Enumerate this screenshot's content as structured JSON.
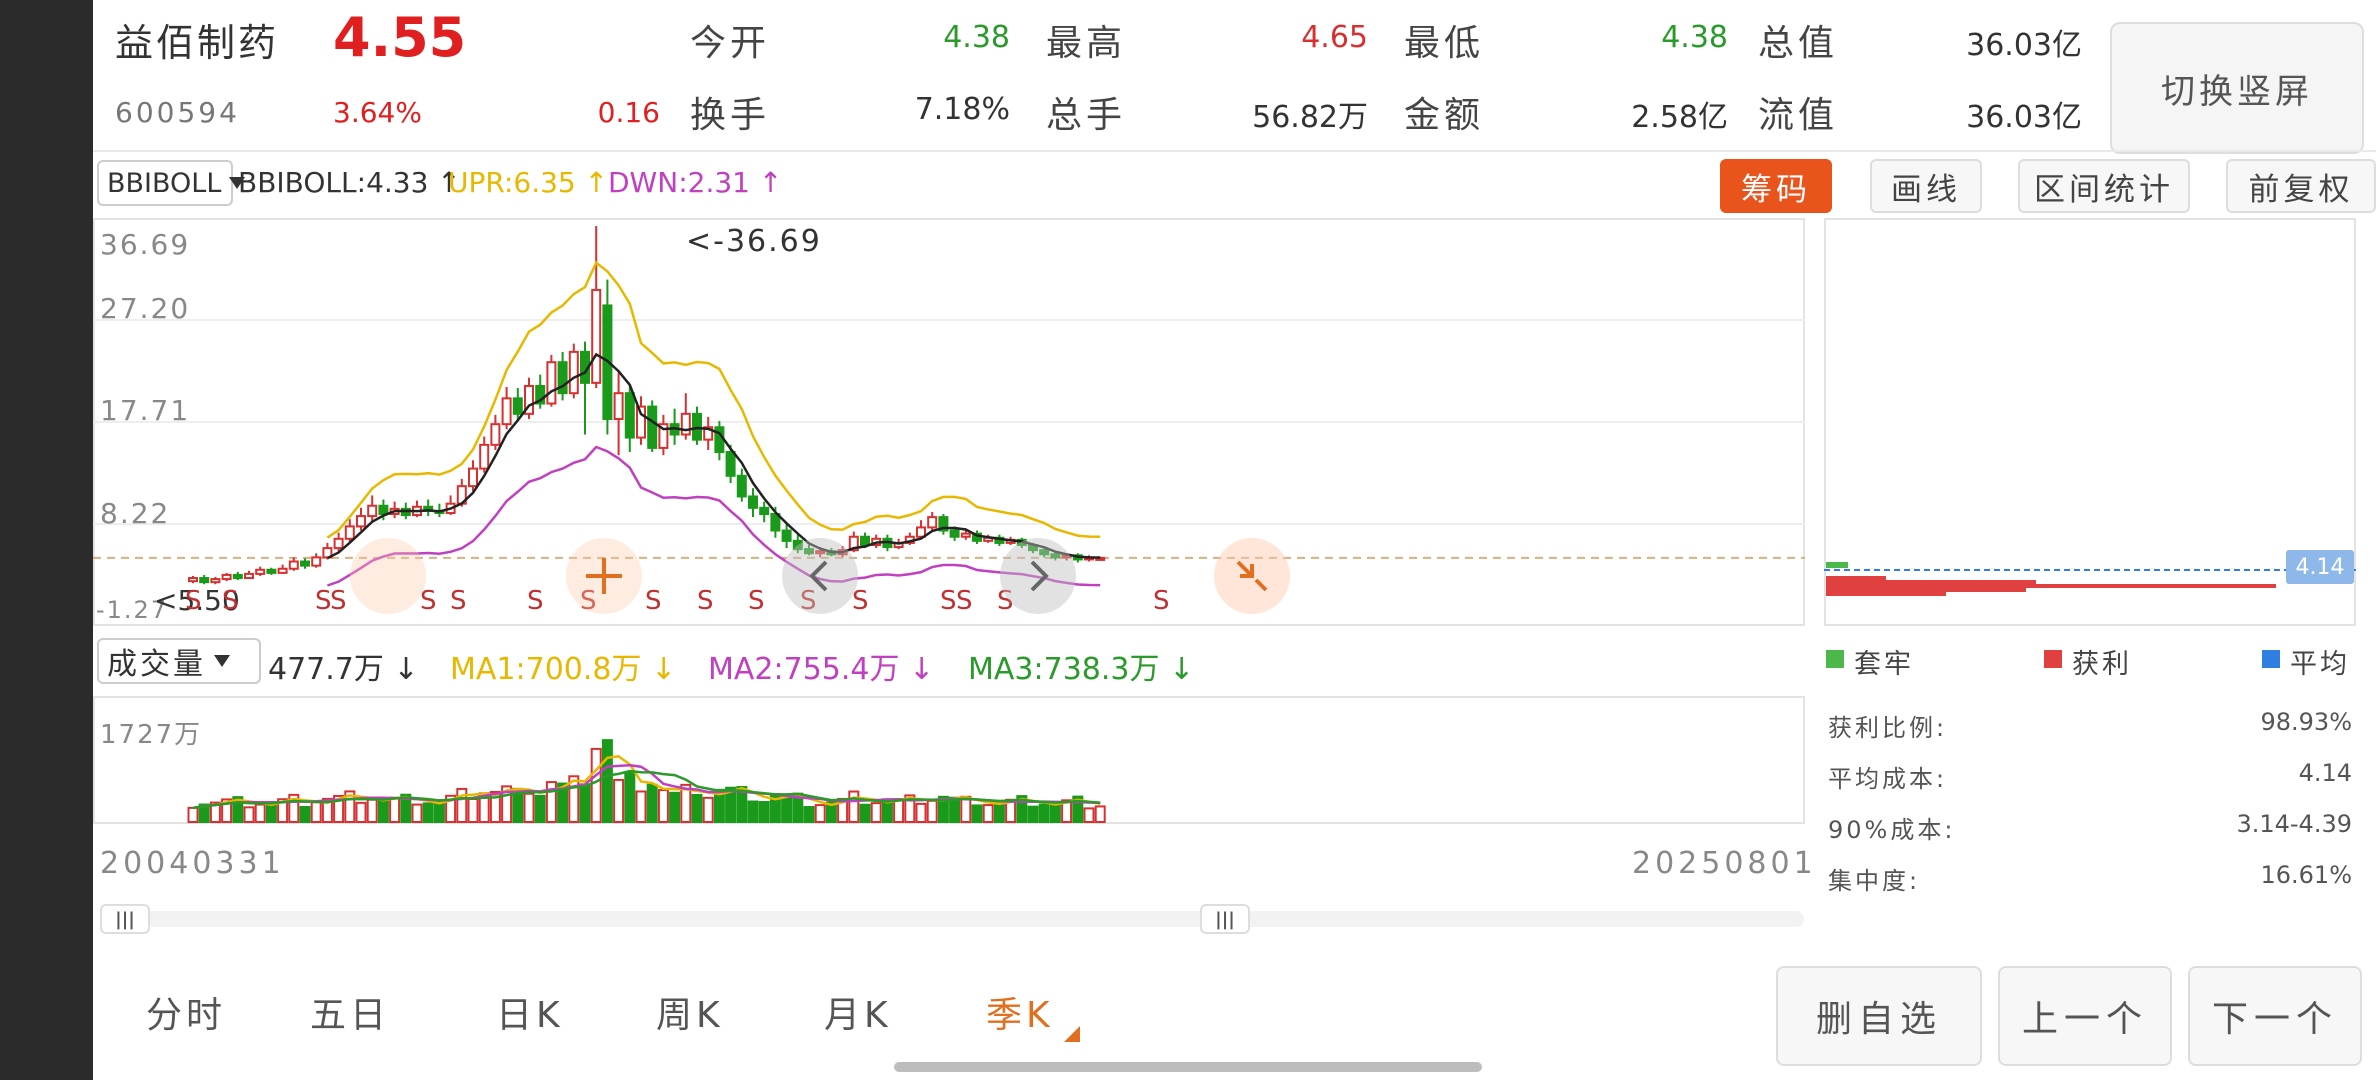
{
  "stock": {
    "name": "益佰制药",
    "price": "4.55",
    "code": "600594",
    "change_pct": "3.64%",
    "change": "0.16"
  },
  "quote": [
    {
      "label": "今开",
      "value": "4.38",
      "color": "#2a9a2a"
    },
    {
      "label": "最高",
      "value": "4.65",
      "color": "#d83030"
    },
    {
      "label": "最低",
      "value": "4.38",
      "color": "#2a9a2a"
    },
    {
      "label": "总值",
      "value": "36.03亿",
      "color": "#333333"
    },
    {
      "label": "换手",
      "value": "7.18%",
      "color": "#333333"
    },
    {
      "label": "总手",
      "value": "56.82万",
      "color": "#333333"
    },
    {
      "label": "金额",
      "value": "2.58亿",
      "color": "#333333"
    },
    {
      "label": "流值",
      "value": "36.03亿",
      "color": "#333333"
    }
  ],
  "switch_label": "切换竖屏",
  "indicator": {
    "selector": "BBIBOLL",
    "bbiboll": "BBIBOLL:4.33 ↑",
    "upr": "UPR:6.35 ↑",
    "dwn": "DWN:2.31 ↑"
  },
  "tools": {
    "chip": "筹码",
    "draw": "画线",
    "range_stats": "区间统计",
    "adjust": "前复权"
  },
  "price_axis": [
    "36.69",
    "27.20",
    "17.71",
    "8.22",
    "-1.27"
  ],
  "peak_label": "<-36.69",
  "low_marker": "<5.50",
  "signal_marker": "S",
  "volume": {
    "selector": "成交量",
    "vol": "477.7万 ↓",
    "ma1": "MA1:700.8万 ↓",
    "ma2": "MA2:755.4万 ↓",
    "ma3": "MA3:738.3万 ↓",
    "axis_top": "1727万"
  },
  "dates": {
    "start": "20040331",
    "end": "20250801"
  },
  "chip_panel": {
    "price_tag": "4.14",
    "legend": [
      {
        "label": "套牢",
        "color": "#4cb84c"
      },
      {
        "label": "获利",
        "color": "#e04040"
      },
      {
        "label": "平均",
        "color": "#2f7fe0"
      }
    ],
    "stats": [
      {
        "label": "获利比例:",
        "value": "98.93%"
      },
      {
        "label": "平均成本:",
        "value": "4.14"
      },
      {
        "label": "90%成本:",
        "value": "3.14-4.39"
      },
      {
        "label": "集中度:",
        "value": "16.61%"
      }
    ]
  },
  "tabs": [
    {
      "label": "分时",
      "active": false
    },
    {
      "label": "五日",
      "active": false
    },
    {
      "label": "日K",
      "active": false
    },
    {
      "label": "周K",
      "active": false
    },
    {
      "label": "月K",
      "active": false
    },
    {
      "label": "季K",
      "active": true
    }
  ],
  "bottom_buttons": {
    "remove_watch": "删自选",
    "prev": "上一个",
    "next": "下一个"
  },
  "colors": {
    "up": "#d83030",
    "down": "#1a9a1a",
    "upr": "#e8b800",
    "dwn": "#c040c0",
    "bbi": "#222222",
    "accent": "#e8541c"
  },
  "chart_data": {
    "type": "candlestick",
    "y_range": [
      -1.27,
      36.69
    ],
    "peak": 36.69,
    "candles": [
      [
        2.3,
        2.6,
        2.1,
        2.8
      ],
      [
        2.6,
        2.2,
        2.0,
        2.9
      ],
      [
        2.2,
        2.5,
        2.0,
        2.7
      ],
      [
        2.5,
        2.9,
        2.3,
        3.1
      ],
      [
        2.9,
        2.6,
        2.4,
        3.2
      ],
      [
        2.6,
        3.0,
        2.5,
        3.3
      ],
      [
        3.0,
        3.4,
        2.8,
        3.7
      ],
      [
        3.4,
        3.1,
        2.9,
        3.6
      ],
      [
        3.1,
        3.5,
        3.0,
        3.9
      ],
      [
        3.5,
        4.2,
        3.3,
        4.6
      ],
      [
        4.2,
        3.8,
        3.5,
        4.5
      ],
      [
        3.8,
        4.6,
        3.6,
        5.0
      ],
      [
        4.6,
        5.5,
        4.4,
        6.0
      ],
      [
        5.5,
        6.4,
        5.2,
        7.0
      ],
      [
        6.4,
        7.6,
        6.0,
        8.3
      ],
      [
        7.6,
        8.6,
        7.2,
        9.4
      ],
      [
        8.6,
        9.6,
        8.1,
        10.6
      ],
      [
        9.6,
        8.8,
        8.2,
        10.2
      ],
      [
        8.8,
        9.3,
        8.4,
        10.0
      ],
      [
        9.3,
        8.7,
        8.3,
        9.9
      ],
      [
        8.7,
        9.5,
        8.5,
        10.1
      ],
      [
        9.5,
        9.1,
        8.6,
        10.2
      ],
      [
        9.1,
        8.9,
        8.5,
        9.8
      ],
      [
        8.9,
        9.8,
        8.7,
        10.6
      ],
      [
        9.8,
        11.5,
        9.5,
        12.2
      ],
      [
        11.5,
        13.2,
        11.0,
        14.0
      ],
      [
        13.2,
        15.5,
        12.8,
        16.3
      ],
      [
        15.5,
        17.5,
        15.0,
        18.4
      ],
      [
        17.5,
        20.0,
        17.0,
        21.1
      ],
      [
        20.0,
        18.5,
        17.8,
        21.0
      ],
      [
        18.5,
        21.2,
        18.0,
        22.0
      ],
      [
        21.2,
        19.5,
        19.0,
        22.3
      ],
      [
        19.5,
        23.5,
        19.2,
        24.2
      ],
      [
        23.5,
        20.5,
        19.8,
        24.5
      ],
      [
        20.5,
        24.5,
        20.0,
        25.3
      ],
      [
        24.5,
        21.5,
        16.5,
        25.5
      ],
      [
        21.5,
        30.5,
        21.0,
        36.69
      ],
      [
        29.0,
        18.0,
        16.5,
        31.5
      ],
      [
        18.0,
        20.5,
        14.5,
        22.5
      ],
      [
        20.5,
        16.2,
        14.8,
        21.4
      ],
      [
        16.2,
        19.2,
        15.5,
        20.2
      ],
      [
        19.2,
        15.2,
        14.8,
        19.8
      ],
      [
        15.2,
        17.5,
        14.5,
        18.4
      ],
      [
        17.5,
        16.5,
        15.5,
        19.0
      ],
      [
        16.5,
        18.5,
        16.0,
        20.5
      ],
      [
        18.5,
        16.0,
        15.5,
        19.2
      ],
      [
        16.0,
        17.2,
        15.0,
        18.2
      ],
      [
        17.2,
        14.8,
        14.0,
        17.8
      ],
      [
        14.8,
        12.5,
        11.8,
        15.5
      ],
      [
        12.5,
        10.5,
        10.0,
        13.2
      ],
      [
        10.5,
        9.4,
        8.5,
        11.3
      ],
      [
        9.4,
        8.8,
        8.0,
        10.0
      ],
      [
        8.8,
        7.2,
        6.5,
        9.5
      ],
      [
        7.2,
        6.2,
        5.5,
        7.8
      ],
      [
        6.2,
        5.4,
        5.0,
        6.8
      ],
      [
        5.4,
        5.0,
        4.8,
        5.8
      ],
      [
        5.0,
        5.2,
        4.6,
        5.6
      ],
      [
        5.2,
        4.9,
        4.7,
        5.5
      ],
      [
        4.9,
        5.3,
        4.6,
        5.7
      ],
      [
        5.3,
        6.6,
        5.1,
        7.1
      ],
      [
        6.6,
        5.8,
        5.5,
        7.0
      ],
      [
        5.8,
        6.4,
        5.5,
        6.8
      ],
      [
        6.4,
        5.6,
        5.2,
        6.8
      ],
      [
        5.6,
        6.0,
        5.4,
        6.4
      ],
      [
        6.0,
        6.6,
        5.8,
        7.0
      ],
      [
        6.6,
        7.5,
        6.4,
        8.2
      ],
      [
        7.5,
        8.5,
        7.2,
        9.0
      ],
      [
        8.5,
        7.2,
        6.8,
        8.8
      ],
      [
        7.2,
        6.6,
        6.2,
        7.6
      ],
      [
        6.6,
        6.9,
        6.3,
        7.3
      ],
      [
        6.9,
        6.2,
        5.9,
        7.2
      ],
      [
        6.2,
        6.5,
        6.0,
        6.8
      ],
      [
        6.5,
        6.0,
        5.7,
        6.8
      ],
      [
        6.0,
        6.3,
        5.8,
        6.6
      ],
      [
        6.3,
        5.8,
        5.5,
        6.5
      ],
      [
        5.8,
        5.3,
        5.0,
        6.0
      ],
      [
        5.3,
        4.9,
        4.6,
        5.5
      ],
      [
        4.9,
        4.6,
        4.3,
        5.1
      ],
      [
        4.6,
        4.8,
        4.3,
        5.0
      ],
      [
        4.8,
        4.4,
        4.1,
        5.0
      ],
      [
        4.4,
        4.6,
        4.2,
        4.8
      ],
      [
        4.38,
        4.55,
        4.38,
        4.65
      ]
    ],
    "volume_max": 1727,
    "volume_unit": "万"
  }
}
